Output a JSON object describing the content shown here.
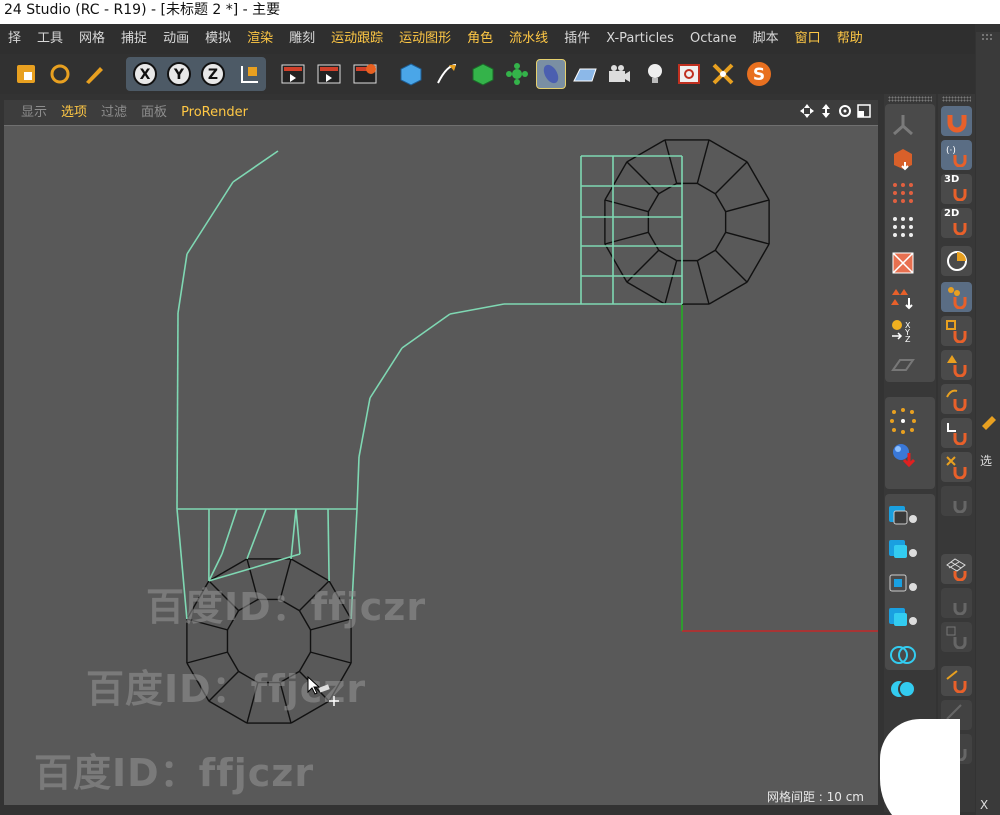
{
  "window": {
    "title": "24 Studio (RC - R19) - [未标题 2 *] - 主要"
  },
  "menubar": {
    "items": [
      {
        "label": "择",
        "highlight": false
      },
      {
        "label": "工具",
        "highlight": false
      },
      {
        "label": "网格",
        "highlight": false
      },
      {
        "label": "捕捉",
        "highlight": false
      },
      {
        "label": "动画",
        "highlight": false
      },
      {
        "label": "模拟",
        "highlight": false
      },
      {
        "label": "渲染",
        "highlight": true
      },
      {
        "label": "雕刻",
        "highlight": false
      },
      {
        "label": "运动跟踪",
        "highlight": true
      },
      {
        "label": "运动图形",
        "highlight": true
      },
      {
        "label": "角色",
        "highlight": true
      },
      {
        "label": "流水线",
        "highlight": true
      },
      {
        "label": "插件",
        "highlight": false
      },
      {
        "label": "X-Particles",
        "highlight": false
      },
      {
        "label": "Octane",
        "highlight": false
      },
      {
        "label": "脚本",
        "highlight": false
      },
      {
        "label": "窗口",
        "highlight": true
      },
      {
        "label": "帮助",
        "highlight": true
      }
    ]
  },
  "toolbar": {
    "axis_x": "X",
    "axis_y": "Y",
    "axis_z": "Z"
  },
  "viewport_menu": {
    "items": [
      {
        "label": "显示",
        "highlight": false
      },
      {
        "label": "选项",
        "highlight": true
      },
      {
        "label": "过滤",
        "highlight": false
      },
      {
        "label": "面板",
        "highlight": false
      },
      {
        "label": "ProRender",
        "highlight": true
      }
    ]
  },
  "viewport": {
    "grid_spacing_label": "网格间距 : 10 cm",
    "watermark_text": "百度ID：ffjczr"
  },
  "palette": {
    "label_3d": "3D",
    "label_2d": "2D"
  },
  "right_edge": {
    "tab_select": "选",
    "tab_x": "X"
  },
  "colors": {
    "selected_edge": "#7fd8b3",
    "mesh_edge": "#111111",
    "axis_y": "#14c814",
    "axis_x": "#d82020",
    "accent": "#ffc845"
  }
}
